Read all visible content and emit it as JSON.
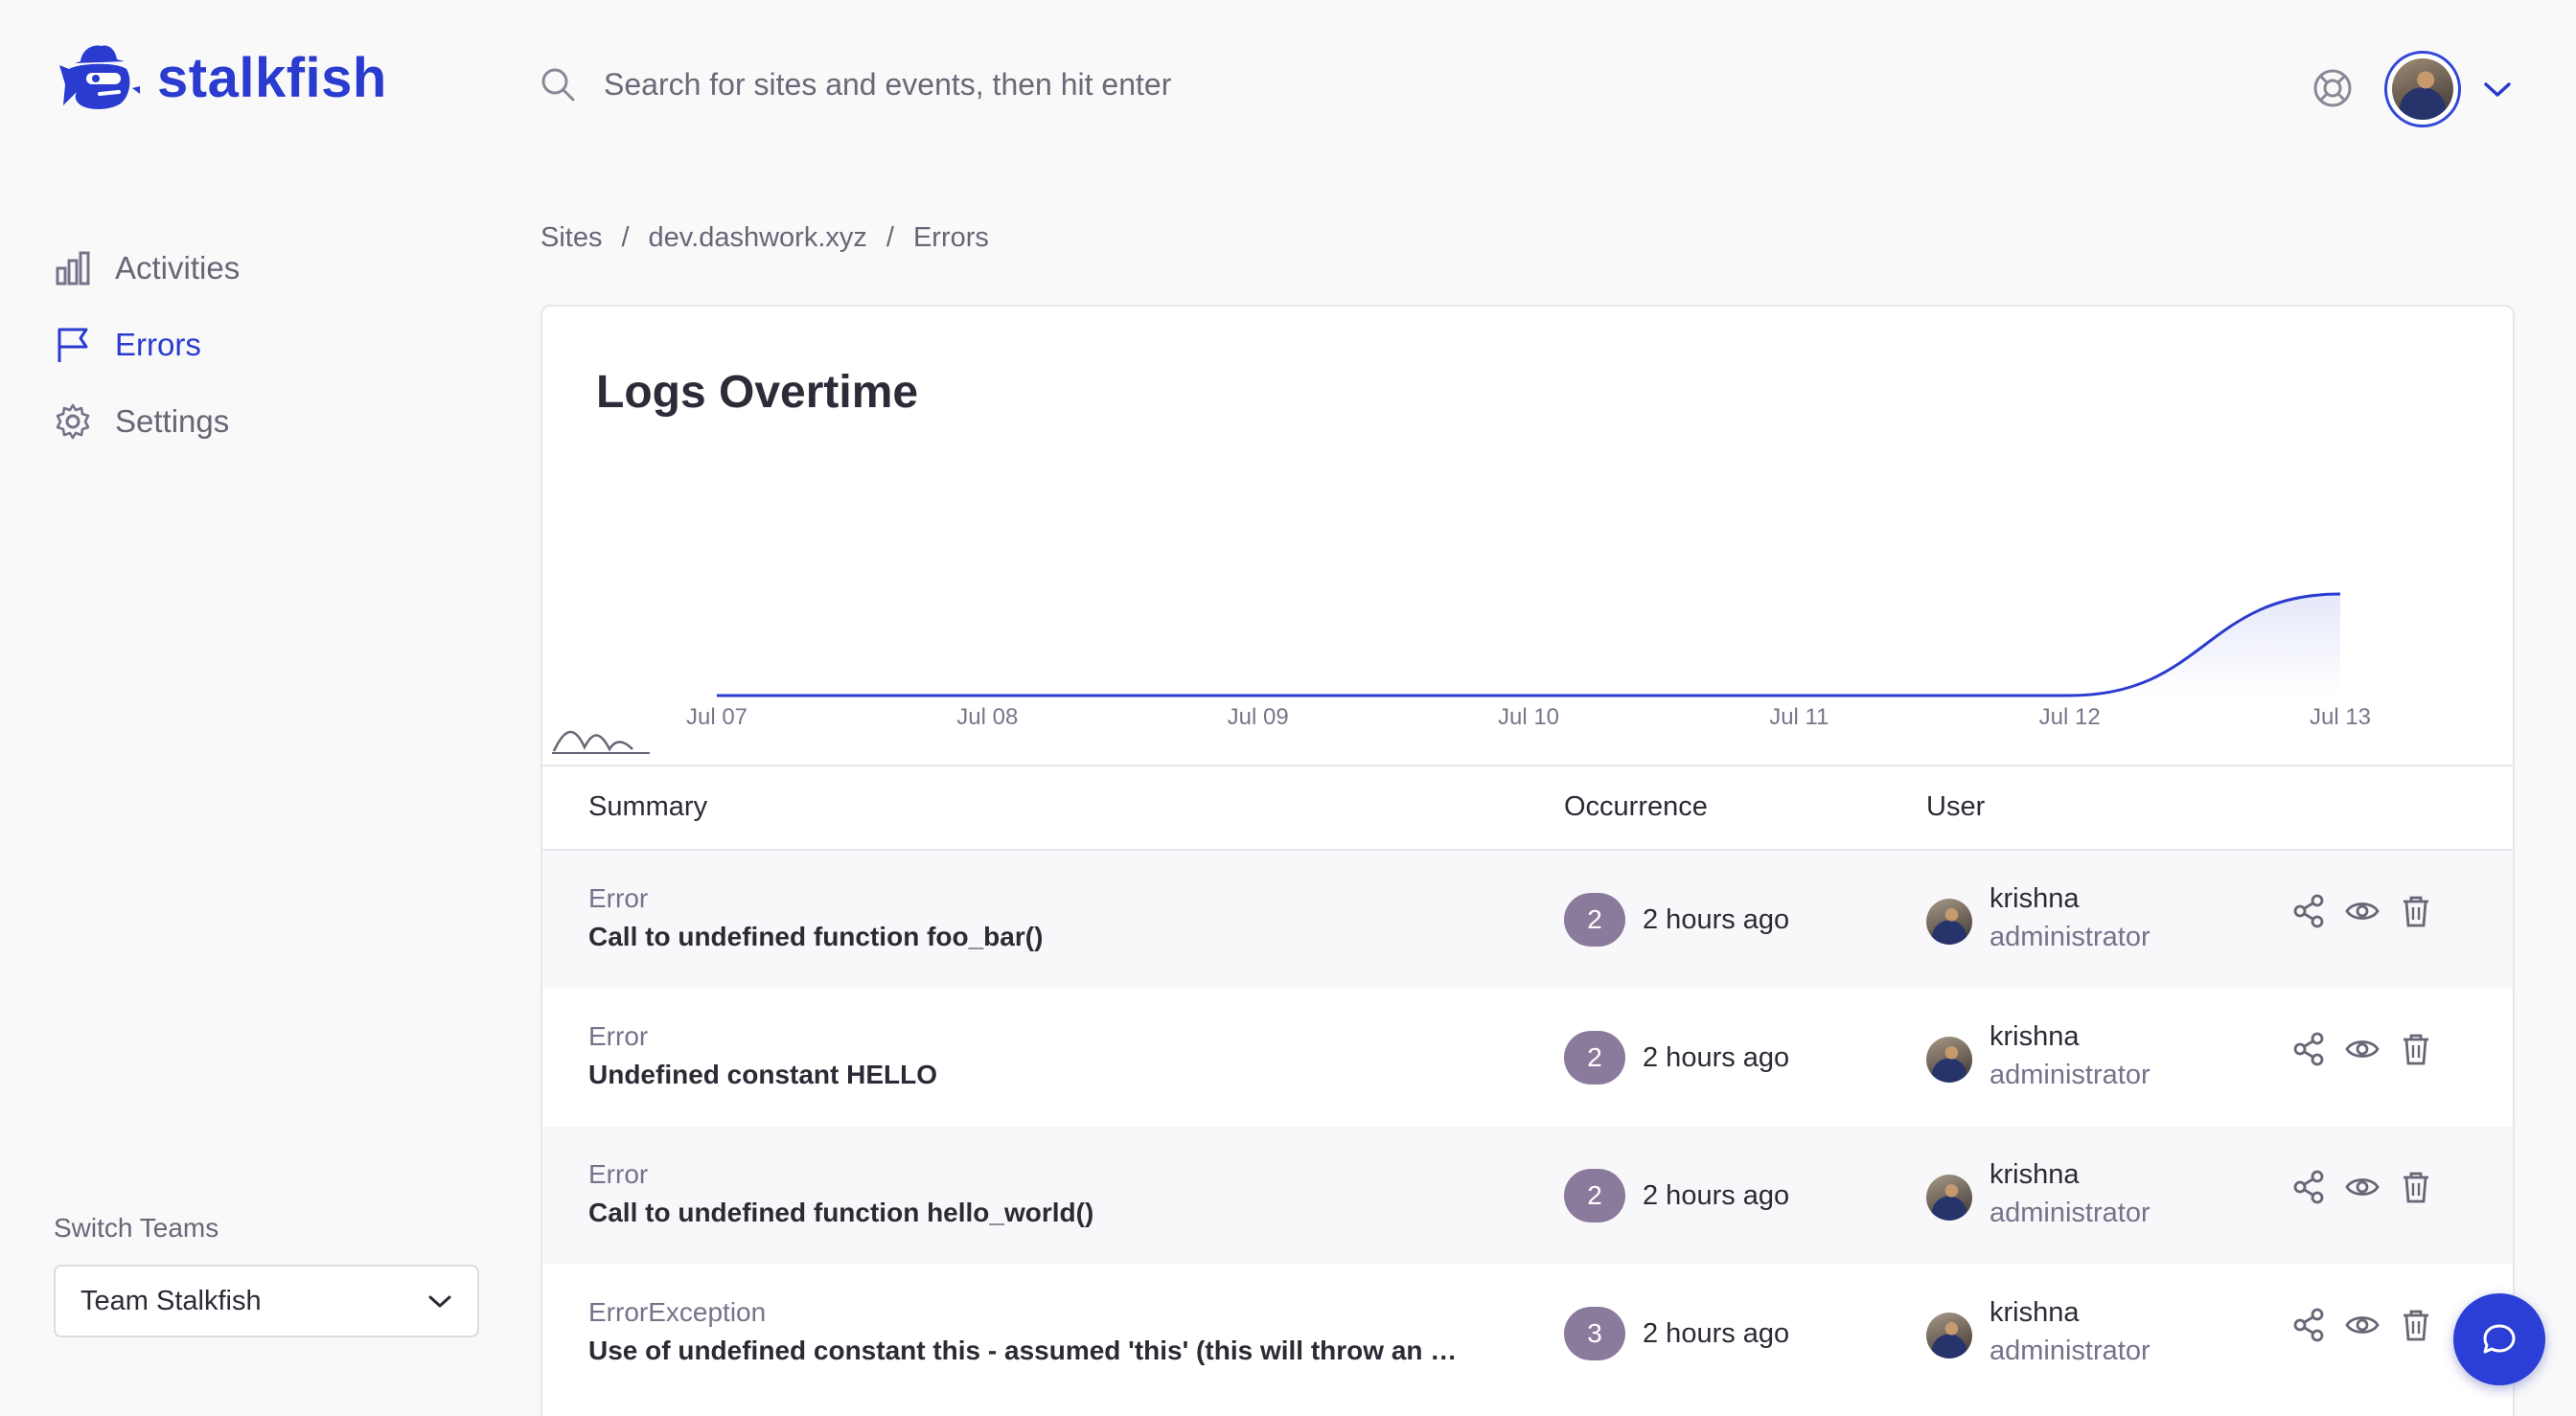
{
  "brand": {
    "name": "stalkfish",
    "color": "#2a3bd0"
  },
  "search": {
    "placeholder": "Search for sites and events, then hit enter"
  },
  "header": {
    "help_icon": "lifebuoy-icon",
    "dropdown_icon": "chevron-down-icon"
  },
  "sidebar": {
    "items": [
      {
        "label": "Activities",
        "icon": "bar-chart-icon",
        "active": false
      },
      {
        "label": "Errors",
        "icon": "flag-icon",
        "active": true
      },
      {
        "label": "Settings",
        "icon": "gear-icon",
        "active": false
      }
    ],
    "switch_teams_label": "Switch Teams",
    "team_selected": "Team Stalkfish"
  },
  "breadcrumb": {
    "items": [
      "Sites",
      "dev.dashwork.xyz",
      "Errors"
    ],
    "separator": "/"
  },
  "card": {
    "title": "Logs Overtime"
  },
  "chart_data": {
    "type": "area",
    "categories": [
      "Jul 07",
      "Jul 08",
      "Jul 09",
      "Jul 10",
      "Jul 11",
      "Jul 12",
      "Jul 13"
    ],
    "values": [
      0,
      0,
      0,
      0,
      0,
      0,
      9
    ],
    "color": "#2a3bd0",
    "grid": false
  },
  "table": {
    "headers": {
      "summary": "Summary",
      "occurrence": "Occurrence",
      "user": "User"
    },
    "rows": [
      {
        "type": "Error",
        "message": "Call to undefined function foo_bar()",
        "count": "2",
        "time": "2 hours ago",
        "user": "krishna",
        "role": "administrator"
      },
      {
        "type": "Error",
        "message": "Undefined constant HELLO",
        "count": "2",
        "time": "2 hours ago",
        "user": "krishna",
        "role": "administrator"
      },
      {
        "type": "Error",
        "message": "Call to undefined function hello_world()",
        "count": "2",
        "time": "2 hours ago",
        "user": "krishna",
        "role": "administrator"
      },
      {
        "type": "ErrorException",
        "message": "Use of undefined constant this - assumed 'this' (this will throw an Error in a future version of PHP)",
        "count": "3",
        "time": "2 hours ago",
        "user": "krishna",
        "role": "administrator"
      }
    ],
    "actions": [
      "share-icon",
      "eye-icon",
      "trash-icon"
    ]
  }
}
